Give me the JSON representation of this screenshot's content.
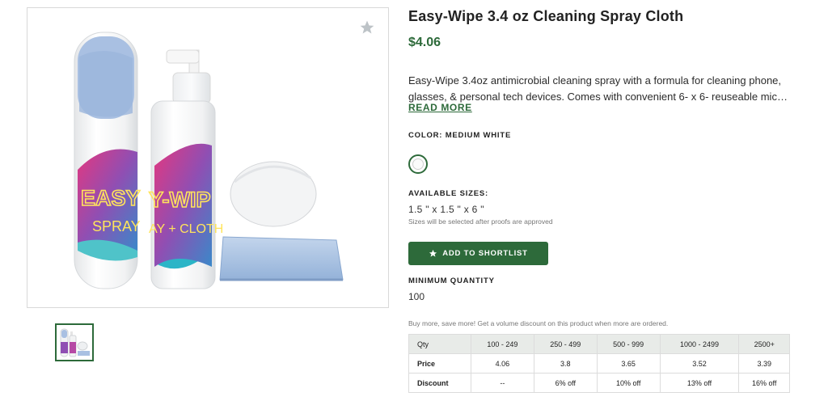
{
  "product": {
    "title": "Easy-Wipe 3.4 oz Cleaning Spray Cloth",
    "price": "$4.06",
    "description_line1": "Easy-Wipe 3.4oz antimicrobial cleaning spray with a formula for cleaning phone,",
    "description_line2": "glasses, & personal tech devices. Comes with convenient 6- x 6- reuseable microfib...",
    "read_more": "READ MORE",
    "bottle_text_left_1": "EASY",
    "bottle_text_left_2": "SPRAY",
    "bottle_text_right_1": "Y-WIP",
    "bottle_text_right_2": "AY + CLOTH"
  },
  "favorite": {
    "icon": "star-icon"
  },
  "color": {
    "label": "COLOR: MEDIUM WHITE",
    "swatch_color": "#fbfbfb"
  },
  "sizes": {
    "label": "AVAILABLE SIZES:",
    "value": "1.5 \" x 1.5 \" x 6 \"",
    "note": "Sizes will be selected after proofs are approved"
  },
  "shortlist": {
    "label": "ADD TO SHORTLIST",
    "icon": "star-icon"
  },
  "min_quantity": {
    "label": "MINIMUM QUANTITY",
    "value": "100"
  },
  "pricing": {
    "promo": "Buy more, save more! Get a volume discount on this product when more are ordered.",
    "header_label": "Qty",
    "qty_ranges": [
      "100 - 249",
      "250 - 499",
      "500 - 999",
      "1000 - 2499",
      "2500+"
    ],
    "price_label": "Price",
    "prices": [
      "4.06",
      "3.8",
      "3.65",
      "3.52",
      "3.39"
    ],
    "discount_label": "Discount",
    "discounts": [
      "--",
      "6% off",
      "10% off",
      "13% off",
      "16% off"
    ]
  },
  "colors": {
    "accent": "#2d6a3a",
    "table_header_bg": "#e8ebe8"
  }
}
